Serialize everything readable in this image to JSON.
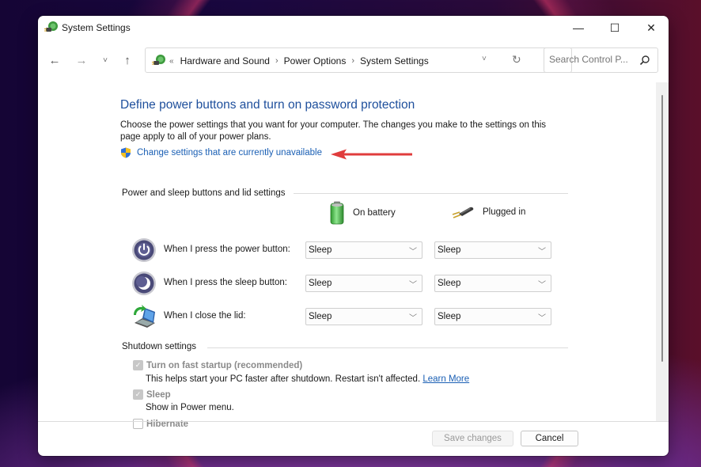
{
  "window": {
    "title": "System Settings",
    "controls": {
      "minimize": "—",
      "maximize": "☐",
      "close": "✕"
    }
  },
  "navbar": {
    "back": "←",
    "forward": "→",
    "recent": "˅",
    "up": "↑",
    "breadcrumb_lead": "«",
    "breadcrumb": [
      "Hardware and Sound",
      "Power Options",
      "System Settings"
    ],
    "breadcrumb_sep": "›",
    "dropdown": "˅",
    "refresh": "↻",
    "search_placeholder": "Search Control P..."
  },
  "main": {
    "heading": "Define power buttons and turn on password protection",
    "description": "Choose the power settings that you want for your computer. The changes you make to the settings on this page apply to all of your power plans.",
    "change_link": "Change settings that are currently unavailable",
    "annotation_color": "#e03c3c",
    "power_group": {
      "label": "Power and sleep buttons and lid settings",
      "columns": [
        "On battery",
        "Plugged in"
      ],
      "rows": [
        {
          "label": "When I press the power button:",
          "icon": "power-button-icon",
          "on_battery": "Sleep",
          "plugged_in": "Sleep"
        },
        {
          "label": "When I press the sleep button:",
          "icon": "sleep-button-icon",
          "on_battery": "Sleep",
          "plugged_in": "Sleep"
        },
        {
          "label": "When I close the lid:",
          "icon": "laptop-lid-icon",
          "on_battery": "Sleep",
          "plugged_in": "Sleep"
        }
      ]
    },
    "shutdown_group": {
      "label": "Shutdown settings",
      "options": [
        {
          "label": "Turn on fast startup (recommended)",
          "checked": true,
          "disabled": true,
          "description": "This helps start your PC faster after shutdown. Restart isn't affected.",
          "link": "Learn More"
        },
        {
          "label": "Sleep",
          "checked": true,
          "disabled": true,
          "description": "Show in Power menu."
        },
        {
          "label": "Hibernate",
          "checked": false,
          "disabled": true
        }
      ]
    }
  },
  "footer": {
    "save_label": "Save changes",
    "cancel_label": "Cancel"
  },
  "colors": {
    "heading": "#1e4f9c",
    "link": "#1a5fb4"
  }
}
